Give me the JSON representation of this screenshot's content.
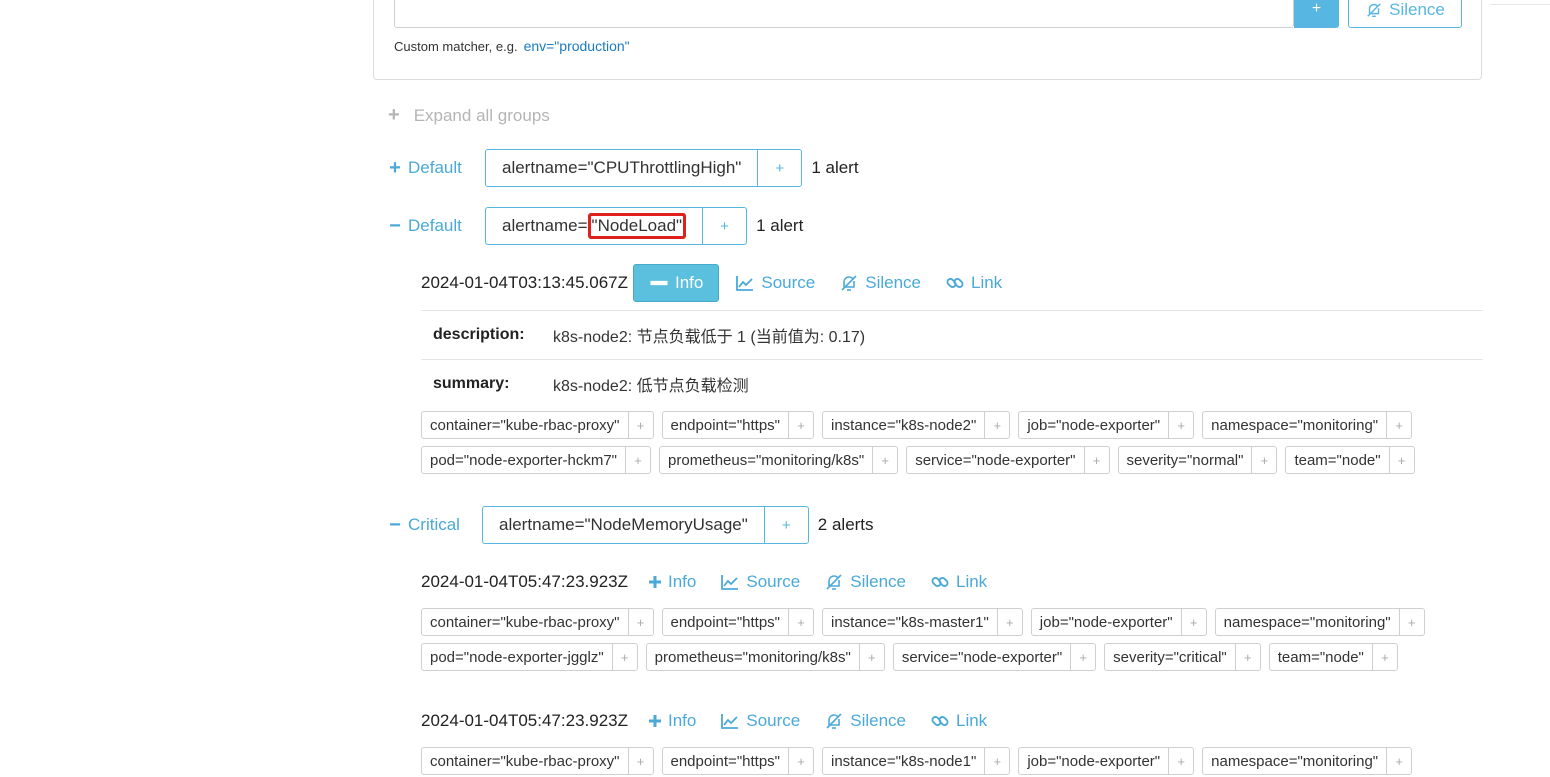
{
  "filter": {
    "add_label": "+",
    "silence_label": "Silence",
    "hint_text": "Custom matcher, e.g.",
    "hint_example": "env=\"production\""
  },
  "expand_all": {
    "label": "Expand all groups"
  },
  "groups": [
    {
      "receiver": "Default",
      "toggle": "+",
      "label_prefix": "alertname=\"CPUThrottlingHigh\"",
      "add": "+",
      "count": "1 alert"
    },
    {
      "receiver": "Default",
      "toggle": "−",
      "label_prefix": "alertname=",
      "label_highlight": "\"NodeLoad\"",
      "add": "+",
      "count": "1 alert",
      "alerts": [
        {
          "timestamp": "2024-01-04T03:13:45.067Z",
          "actions": {
            "info": "Info",
            "source": "Source",
            "silence": "Silence",
            "link": "Link"
          },
          "annotations": [
            {
              "key": "description:",
              "value": "k8s-node2: 节点负载低于 1 (当前值为: 0.17)"
            },
            {
              "key": "summary:",
              "value": "k8s-node2: 低节点负载检测"
            }
          ],
          "labels_row1": [
            "container=\"kube-rbac-proxy\"",
            "endpoint=\"https\"",
            "instance=\"k8s-node2\"",
            "job=\"node-exporter\"",
            "namespace=\"monitoring\""
          ],
          "labels_row2": [
            "pod=\"node-exporter-hckm7\"",
            "prometheus=\"monitoring/k8s\"",
            "service=\"node-exporter\"",
            "severity=\"normal\"",
            "team=\"node\""
          ]
        }
      ]
    },
    {
      "receiver": "Critical",
      "toggle": "−",
      "label_prefix": "alertname=\"NodeMemoryUsage\"",
      "add": "+",
      "count": "2 alerts",
      "alerts": [
        {
          "timestamp": "2024-01-04T05:47:23.923Z",
          "actions": {
            "info": "Info",
            "source": "Source",
            "silence": "Silence",
            "link": "Link"
          },
          "labels_row1": [
            "container=\"kube-rbac-proxy\"",
            "endpoint=\"https\"",
            "instance=\"k8s-master1\"",
            "job=\"node-exporter\"",
            "namespace=\"monitoring\""
          ],
          "labels_row2": [
            "pod=\"node-exporter-jgglz\"",
            "prometheus=\"monitoring/k8s\"",
            "service=\"node-exporter\"",
            "severity=\"critical\"",
            "team=\"node\""
          ]
        },
        {
          "timestamp": "2024-01-04T05:47:23.923Z",
          "actions": {
            "info": "Info",
            "source": "Source",
            "silence": "Silence",
            "link": "Link"
          },
          "labels_row1": [
            "container=\"kube-rbac-proxy\"",
            "endpoint=\"https\"",
            "instance=\"k8s-node1\"",
            "job=\"node-exporter\"",
            "namespace=\"monitoring\""
          ]
        }
      ]
    }
  ],
  "chip_add": "+",
  "colors": {
    "accent": "#58b6e2",
    "link": "#4aa9d9",
    "highlight": "#e0201c"
  }
}
